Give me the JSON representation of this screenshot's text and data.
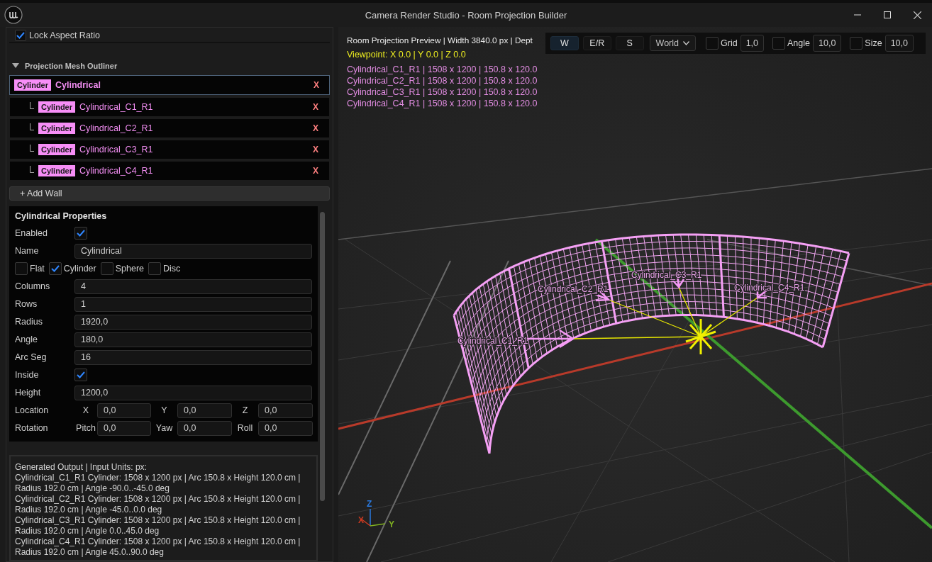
{
  "window": {
    "title": "Camera Render Studio - Room Projection Builder"
  },
  "lock_aspect_ratio": {
    "label": "Lock Aspect Ratio",
    "checked": true
  },
  "outliner": {
    "title": "Projection Mesh Outliner",
    "expanded": true,
    "items": [
      {
        "badge": "Cylinder",
        "name": "Cylindrical",
        "delete": "X",
        "selected": true,
        "children": [
          {
            "badge": "Cylinder",
            "name": "Cylindrical_C1_R1",
            "delete": "X",
            "selected": false
          },
          {
            "badge": "Cylinder",
            "name": "Cylindrical_C2_R1",
            "delete": "X",
            "selected": false
          },
          {
            "badge": "Cylinder",
            "name": "Cylindrical_C3_R1",
            "delete": "X",
            "selected": false
          },
          {
            "badge": "Cylinder",
            "name": "Cylindrical_C4_R1",
            "delete": "X",
            "selected": false
          }
        ]
      }
    ]
  },
  "add_wall_button": "+ Add Wall",
  "properties": {
    "title": "Cylindrical Properties",
    "rows": [
      {
        "kind": "checkbox",
        "label": "Enabled",
        "checked": true
      },
      {
        "kind": "field",
        "label": "Name",
        "value": "Cylindrical"
      },
      {
        "kind": "options",
        "options": [
          {
            "label": "Flat",
            "checked": false
          },
          {
            "label": "Cylinder",
            "checked": true
          },
          {
            "label": "Sphere",
            "checked": false
          },
          {
            "label": "Disc",
            "checked": false
          }
        ]
      },
      {
        "kind": "field",
        "label": "Columns",
        "value": "4"
      },
      {
        "kind": "field",
        "label": "Rows",
        "value": "1"
      },
      {
        "kind": "field",
        "label": "Radius",
        "value": "1920,0"
      },
      {
        "kind": "field",
        "label": "Angle",
        "value": "180,0"
      },
      {
        "kind": "field",
        "label": "Arc Seg",
        "value": "16"
      },
      {
        "kind": "checkbox",
        "label": "Inside",
        "checked": true
      },
      {
        "kind": "field",
        "label": "Height",
        "value": "1200,0"
      },
      {
        "kind": "vector",
        "label": "Location",
        "fields": [
          {
            "axis": "X",
            "value": "0,0"
          },
          {
            "axis": "Y",
            "value": "0,0"
          },
          {
            "axis": "Z",
            "value": "0,0"
          }
        ]
      },
      {
        "kind": "vector",
        "label": "Rotation",
        "fields": [
          {
            "axis": "Pitch",
            "value": "0,0"
          },
          {
            "axis": "Yaw",
            "value": "0,0"
          },
          {
            "axis": "Roll",
            "value": "0,0"
          }
        ]
      }
    ]
  },
  "output": {
    "lines": [
      "Generated Output | Input Units: px:",
      "Cylindrical_C1_R1 Cylinder: 1508 x 1200 px | Arc 150.8 x Height 120.0 cm |",
      "Radius 192.0 cm | Angle -90.0..-45.0 deg",
      "Cylindrical_C2_R1 Cylinder: 1508 x 1200 px | Arc 150.8 x Height 120.0 cm |",
      "Radius 192.0 cm | Angle -45.0..0.0 deg",
      "Cylindrical_C3_R1 Cylinder: 1508 x 1200 px | Arc 150.8 x Height 120.0 cm |",
      "Radius 192.0 cm | Angle 0.0..45.0 deg",
      "Cylindrical_C4_R1 Cylinder: 1508 x 1200 px | Arc 150.8 x Height 120.0 cm |",
      "Radius 192.0 cm | Angle 45.0..90.0 deg"
    ]
  },
  "viewport": {
    "info": "Room Projection Preview | Width 3840.0 px | Dept",
    "viewpoint": "Viewpoint: X 0.0 | Y 0.0 | Z 0.0",
    "mesh_list": [
      "Cylindrical_C1_R1 | 1508 x 1200 | 150.8 x 120.0",
      "Cylindrical_C2_R1 | 1508 x 1200 | 150.8 x 120.0",
      "Cylindrical_C3_R1 | 1508 x 1200 | 150.8 x 120.0",
      "Cylindrical_C4_R1 | 1508 x 1200 | 150.8 x 120.0"
    ],
    "toolbar": {
      "modes": [
        {
          "label": "W",
          "selected": true
        },
        {
          "label": "E/R",
          "selected": false
        },
        {
          "label": "S",
          "selected": false
        }
      ],
      "space": "World",
      "snaps": [
        {
          "label": "Grid",
          "checked": false,
          "value": "1,0"
        },
        {
          "label": "Angle",
          "checked": false,
          "value": "10,0"
        },
        {
          "label": "Size",
          "checked": false,
          "value": "10,0"
        }
      ]
    },
    "scene_labels": [
      "Cylindrical_C1_R1",
      "Cylindrical_C2_R1",
      "Cylindrical_C3_R1",
      "Cylindrical_C4_R1"
    ],
    "gizmo": {
      "z": "Z",
      "x": "X",
      "y": "Y"
    }
  }
}
